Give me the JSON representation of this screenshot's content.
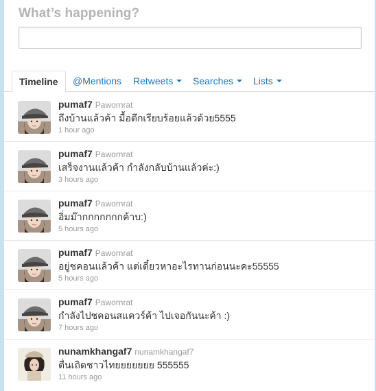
{
  "compose": {
    "title": "What’s happening?",
    "value": ""
  },
  "tabs": [
    {
      "label": "Timeline",
      "active": true,
      "dropdown": false
    },
    {
      "label": "@Mentions",
      "active": false,
      "dropdown": false
    },
    {
      "label": "Retweets",
      "active": false,
      "dropdown": true
    },
    {
      "label": "Searches",
      "active": false,
      "dropdown": true
    },
    {
      "label": "Lists",
      "active": false,
      "dropdown": true
    }
  ],
  "tweets": [
    {
      "username": "pumaf7",
      "fullname": "Pawornrat",
      "text": "ถึงบ้านแล้วค้า มื้อตึกเรียบร้อยแล้วด้วย5555",
      "time": "1 hour ago",
      "avatar": "girl-cap"
    },
    {
      "username": "pumaf7",
      "fullname": "Pawornrat",
      "text": "เสร็จงานแล้วค้า กำลังกลับบ้านแล้วค่ะ:)",
      "time": "3 hours ago",
      "avatar": "girl-cap"
    },
    {
      "username": "pumaf7",
      "fullname": "Pawornrat",
      "text": "อิ่มม๊ากกกกกกกค้าบ:)",
      "time": "5 hours ago",
      "avatar": "girl-cap"
    },
    {
      "username": "pumaf7",
      "fullname": "Pawornrat",
      "text": "อยู่ชคอนแล้วค้า แต่เดี๋ยวหาอะไรทานก่อนนะคะ55555",
      "time": "5 hours ago",
      "avatar": "girl-cap"
    },
    {
      "username": "pumaf7",
      "fullname": "Pawornrat",
      "text": "กำลังไปชคอนสแควร์ค้า ไปเจอกันนะค้า :)",
      "time": "7 hours ago",
      "avatar": "girl-cap"
    },
    {
      "username": "nunamkhangaf7",
      "fullname": "nunamkhangaf7",
      "text": "ตื่นเถิดชาวไทยยยยยยย 555555",
      "time": "11 hours ago",
      "avatar": "girl-hat"
    }
  ]
}
